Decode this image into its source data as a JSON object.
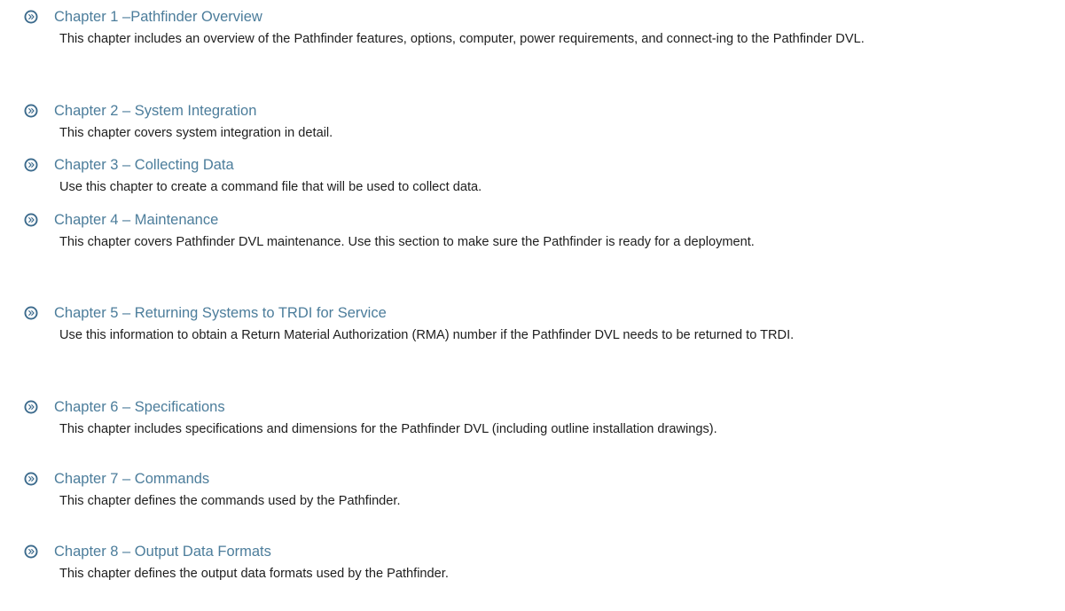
{
  "bullet_icon": "circled-arrow-icon",
  "colors": {
    "heading": "#4c7d9b",
    "body_text": "#1e1e1e",
    "bullet_fill": "#3b6a8c"
  },
  "chapters": [
    {
      "title": "Chapter 1 –Pathfinder Overview",
      "description": "This chapter includes an overview of the Pathfinder features, options, computer, power requirements, and connect-ing to the Pathfinder DVL."
    },
    {
      "title": "Chapter 2 – System Integration",
      "description": "This chapter covers system integration in detail."
    },
    {
      "title": "Chapter 3 – Collecting Data",
      "description": "Use this chapter to create a command file that will be used to collect data."
    },
    {
      "title": "Chapter 4 – Maintenance",
      "description": "This chapter covers Pathfinder DVL maintenance. Use this section to make sure the Pathfinder is ready for a deployment."
    },
    {
      "title": "Chapter 5 – Returning Systems to TRDI for Service",
      "description": "Use this information to obtain a Return Material Authorization (RMA) number if the Pathfinder DVL needs to be returned to TRDI."
    },
    {
      "title": "Chapter 6 – Specifications",
      "description": "This chapter includes specifications and dimensions for the Pathfinder DVL (including outline installation drawings)."
    },
    {
      "title": "Chapter 7 – Commands",
      "description": "This chapter defines the commands used by the Pathfinder."
    },
    {
      "title": "Chapter 8 – Output Data Formats",
      "description": "This chapter defines the output data formats used by the Pathfinder."
    }
  ]
}
